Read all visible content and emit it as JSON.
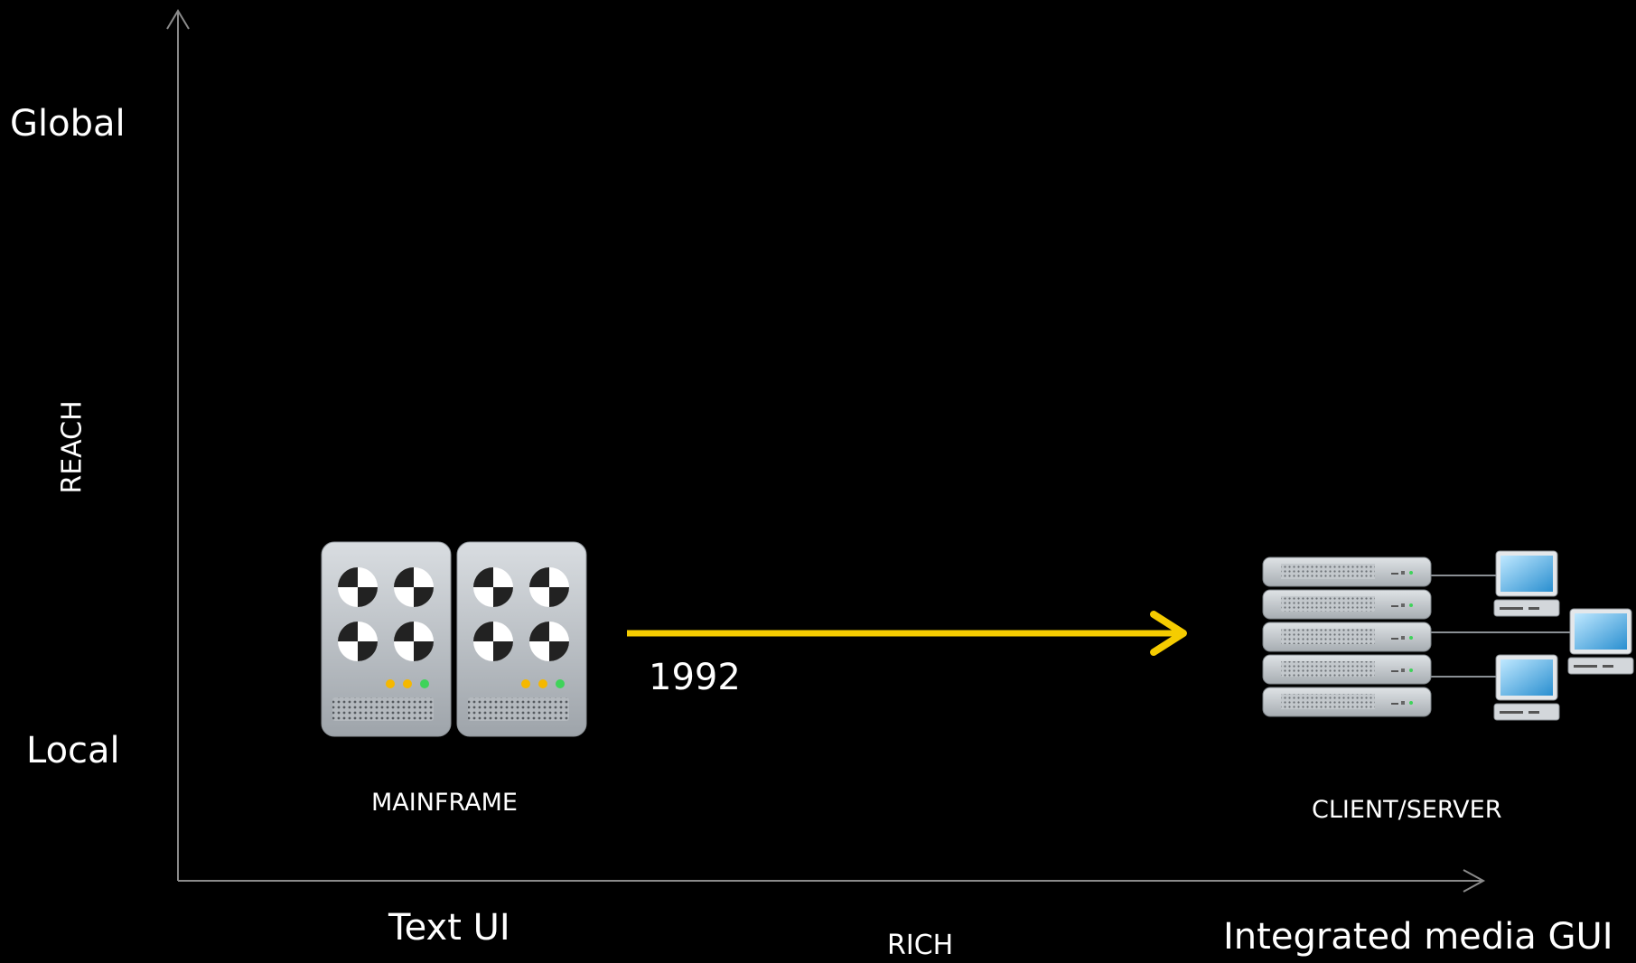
{
  "axes": {
    "y_label": "REACH",
    "x_label": "RICH",
    "y_top": "Global",
    "y_bottom": "Local",
    "x_left": "Text UI",
    "x_right": "Integrated media GUI"
  },
  "items": {
    "mainframe_label": "MAINFRAME",
    "client_server_label": "CLIENT/SERVER",
    "transition_year": "1992"
  },
  "colors": {
    "background": "#000000",
    "axis": "#8a8a8a",
    "arrow": "#f5cc00",
    "text": "#ffffff"
  },
  "icons": [
    "mainframe-icon",
    "server-rack-icon",
    "computer-icon"
  ]
}
